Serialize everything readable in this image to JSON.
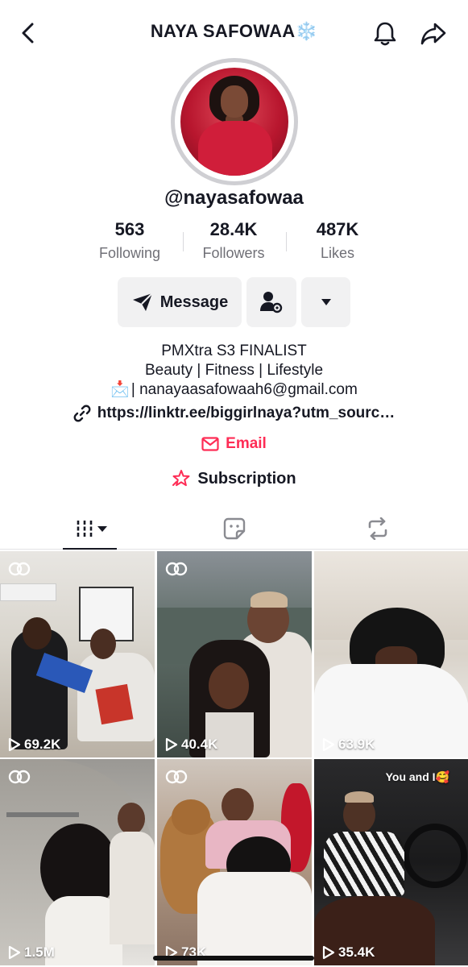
{
  "header": {
    "title": "NAYA SAFOWAA❄️",
    "back_icon": "chevron-left-icon",
    "bell_icon": "bell-icon",
    "share_icon": "share-arrow-icon"
  },
  "profile": {
    "username": "@nayasafowaa",
    "stats": [
      {
        "value": "563",
        "label": "Following"
      },
      {
        "value": "28.4K",
        "label": "Followers"
      },
      {
        "value": "487K",
        "label": "Likes"
      }
    ],
    "buttons": {
      "message_label": "Message"
    },
    "bio": {
      "line1": "PMXtra S3 FINALIST",
      "line2": "Beauty | Fitness | Lifestyle",
      "email_emoji": "📩",
      "email_text": "| nanayaasafowaah6@gmail.com"
    },
    "link": "https://linktr.ee/biggirlnaya?utm_sourc…",
    "email_button": "Email",
    "subscription_button": "Subscription"
  },
  "tabs": [
    {
      "name": "videos",
      "icon": "grid-icon",
      "active": true
    },
    {
      "name": "favorites",
      "icon": "sticker-icon",
      "active": false
    },
    {
      "name": "reposts",
      "icon": "repost-icon",
      "active": false
    }
  ],
  "videos": [
    {
      "views": "69.2K"
    },
    {
      "views": "40.4K"
    },
    {
      "views": "63.9K"
    },
    {
      "views": "1.5M"
    },
    {
      "views": "73K"
    },
    {
      "views": "35.4K",
      "caption": "You and I🥰"
    }
  ],
  "colors": {
    "accent": "#fe2c55",
    "text": "#161823",
    "muted": "#6f6f76",
    "button_bg": "#f1f1f2"
  }
}
